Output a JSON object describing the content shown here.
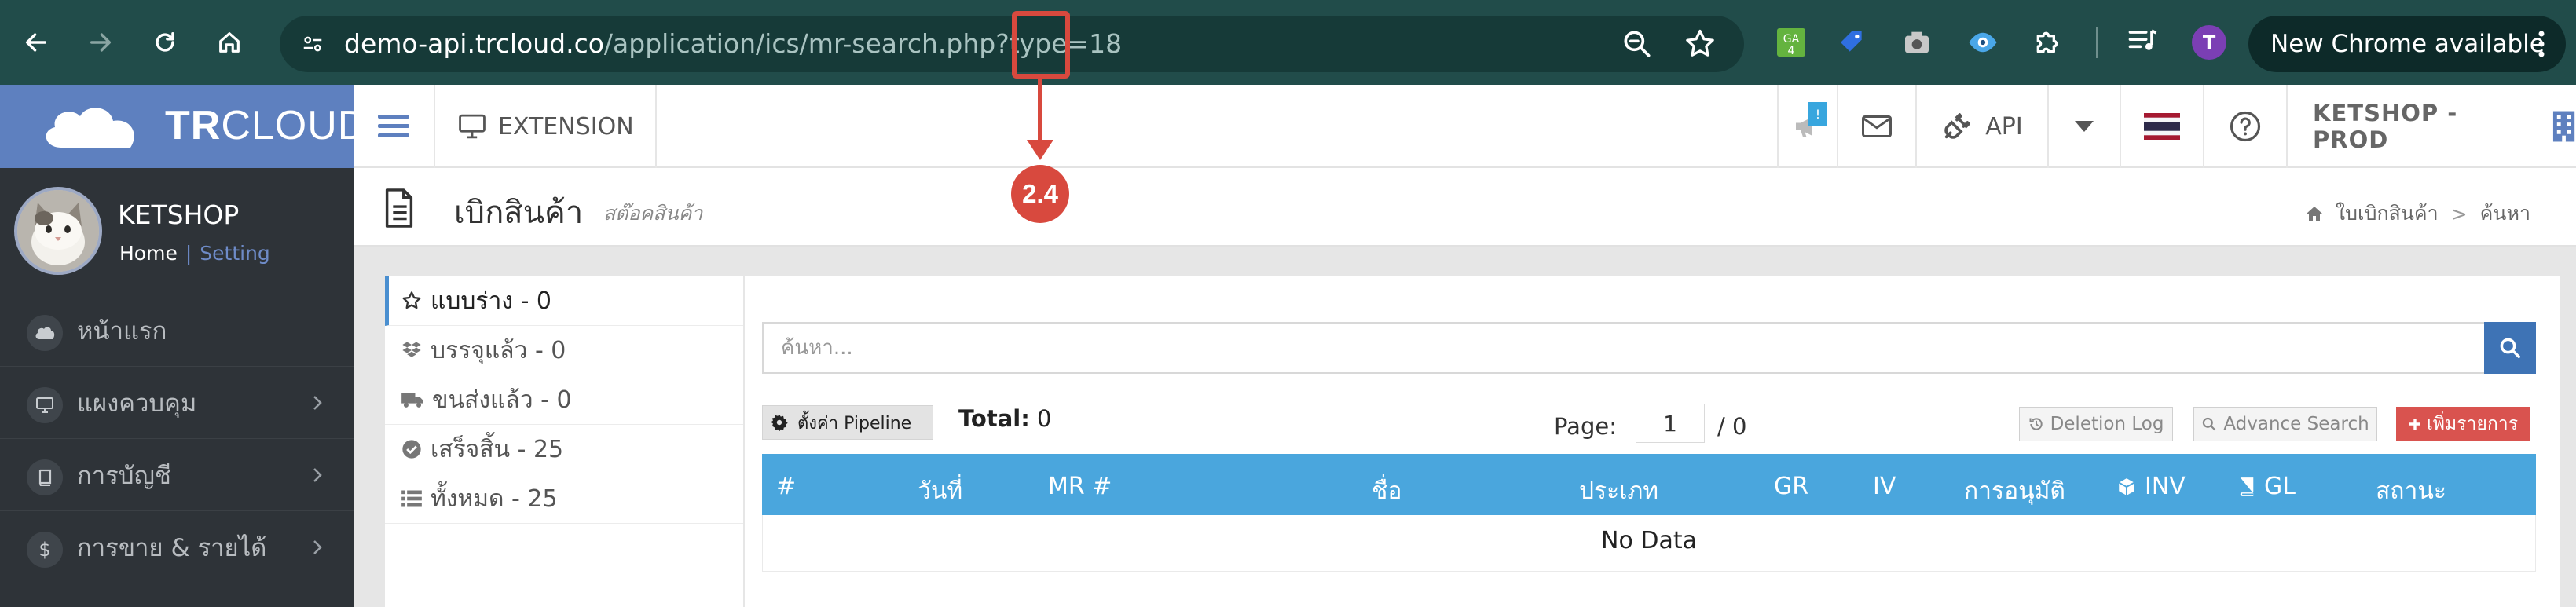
{
  "browser": {
    "url_host": "demo-api.trcloud.co",
    "url_path": "/application/ics/mr-search.php?type=18",
    "profile_initial": "T",
    "update_label": "New Chrome available",
    "extensions": [
      "ga-icon",
      "tag-icon",
      "camera-icon",
      "eye-icon",
      "puzzle-icon"
    ]
  },
  "header": {
    "logo_bold": "TR",
    "logo_light": "CLOUD",
    "extension_label": "EXTENSION",
    "notify_badge": "!",
    "api_label": "API",
    "company": "KETSHOP - PROD"
  },
  "sidebar": {
    "user_name": "KETSHOP",
    "home_link": "Home",
    "link_sep": "|",
    "setting_link": "Setting",
    "items": [
      {
        "label": "หน้าแรก",
        "icon": "cloud-icon",
        "chevron": false
      },
      {
        "label": "แผงควบคุม",
        "icon": "monitor-icon",
        "chevron": true
      },
      {
        "label": "การบัญชี",
        "icon": "book-icon",
        "chevron": true
      },
      {
        "label": "การขาย & รายได้",
        "icon": "dollar-icon",
        "chevron": true
      }
    ]
  },
  "page": {
    "title": "เบิกสินค้า",
    "subtitle": "สต๊อคสินค้า",
    "breadcrumb": [
      "ใบเบิกสินค้า",
      "ค้นหา"
    ]
  },
  "status_list": [
    {
      "label": "แบบร่าง - 0",
      "icon": "star-icon",
      "active": true
    },
    {
      "label": "บรรจุแล้ว - 0",
      "icon": "dropbox-icon",
      "active": false
    },
    {
      "label": "ขนส่งแล้ว - 0",
      "icon": "truck-icon",
      "active": false
    },
    {
      "label": "เสร็จสิ้น - 25",
      "icon": "check-circle-icon",
      "active": false
    },
    {
      "label": "ทั้งหมด - 25",
      "icon": "list-icon",
      "active": false
    }
  ],
  "search": {
    "placeholder": "ค้นหา..."
  },
  "toolbar": {
    "pipeline_label": "ตั้งค่า Pipeline",
    "total_label": "Total:",
    "total_value": "0",
    "page_label": "Page:",
    "page_value": "1",
    "page_total": "/ 0",
    "deletion_log": "Deletion Log",
    "advance_search": "Advance Search",
    "add_label": "เพิ่มรายการ"
  },
  "table": {
    "columns": [
      "#",
      "วันที่",
      "MR #",
      "ชื่อ",
      "ประเภท",
      "GR",
      "IV",
      "การอนุมัติ",
      "INV",
      "GL",
      "สถานะ"
    ],
    "empty_text": "No Data"
  },
  "annotation": {
    "label": "2.4"
  },
  "colors": {
    "chrome_bg": "#214c4a",
    "logo_bg": "#5e80bf",
    "sidebar_bg": "#2e3338",
    "table_header": "#4aa6dd",
    "add_button": "#d9534f",
    "annotation": "#d8493e"
  }
}
